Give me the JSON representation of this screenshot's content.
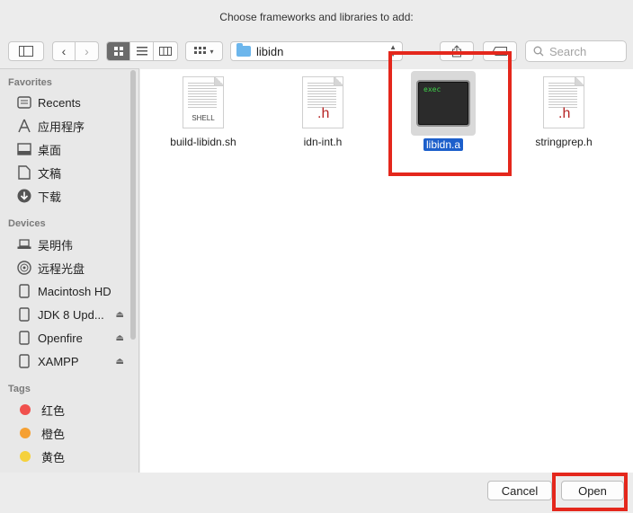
{
  "window": {
    "title": "Choose frameworks and libraries to add:"
  },
  "toolbar": {
    "path": "libidn",
    "search_placeholder": "Search",
    "view_modes": [
      "icon",
      "list",
      "column"
    ],
    "active_view": "icon"
  },
  "sidebar": {
    "favorites_header": "Favorites",
    "favorites": [
      {
        "label": "Recents",
        "icon": "recents-icon"
      },
      {
        "label": "应用程序",
        "icon": "applications-icon"
      },
      {
        "label": "桌面",
        "icon": "desktop-icon"
      },
      {
        "label": "文稿",
        "icon": "documents-icon"
      },
      {
        "label": "下载",
        "icon": "downloads-icon"
      }
    ],
    "devices_header": "Devices",
    "devices": [
      {
        "label": "吴明伟",
        "icon": "computer-icon"
      },
      {
        "label": "远程光盘",
        "icon": "disc-icon"
      },
      {
        "label": "Macintosh HD",
        "icon": "harddisk-icon"
      },
      {
        "label": "JDK 8 Upd...",
        "icon": "volume-icon",
        "eject": true
      },
      {
        "label": "Openfire",
        "icon": "volume-icon",
        "eject": true
      },
      {
        "label": "XAMPP",
        "icon": "volume-icon",
        "eject": true
      }
    ],
    "tags_header": "Tags",
    "tags": [
      {
        "label": "红色",
        "color": "#f0504d"
      },
      {
        "label": "橙色",
        "color": "#f5a033"
      },
      {
        "label": "黄色",
        "color": "#f5d13c"
      }
    ]
  },
  "files": [
    {
      "name": "build-libidn.sh",
      "kind": "shell",
      "badge": "SHELL"
    },
    {
      "name": "idn-int.h",
      "kind": "header",
      "badge": ".h"
    },
    {
      "name": "libidn.a",
      "kind": "exec",
      "badge": "exec",
      "selected": true
    },
    {
      "name": "stringprep.h",
      "kind": "header",
      "badge": ".h"
    }
  ],
  "buttons": {
    "cancel": "Cancel",
    "open": "Open"
  },
  "colors": {
    "highlight": "#e4271c",
    "selection": "#1c5fcb"
  }
}
